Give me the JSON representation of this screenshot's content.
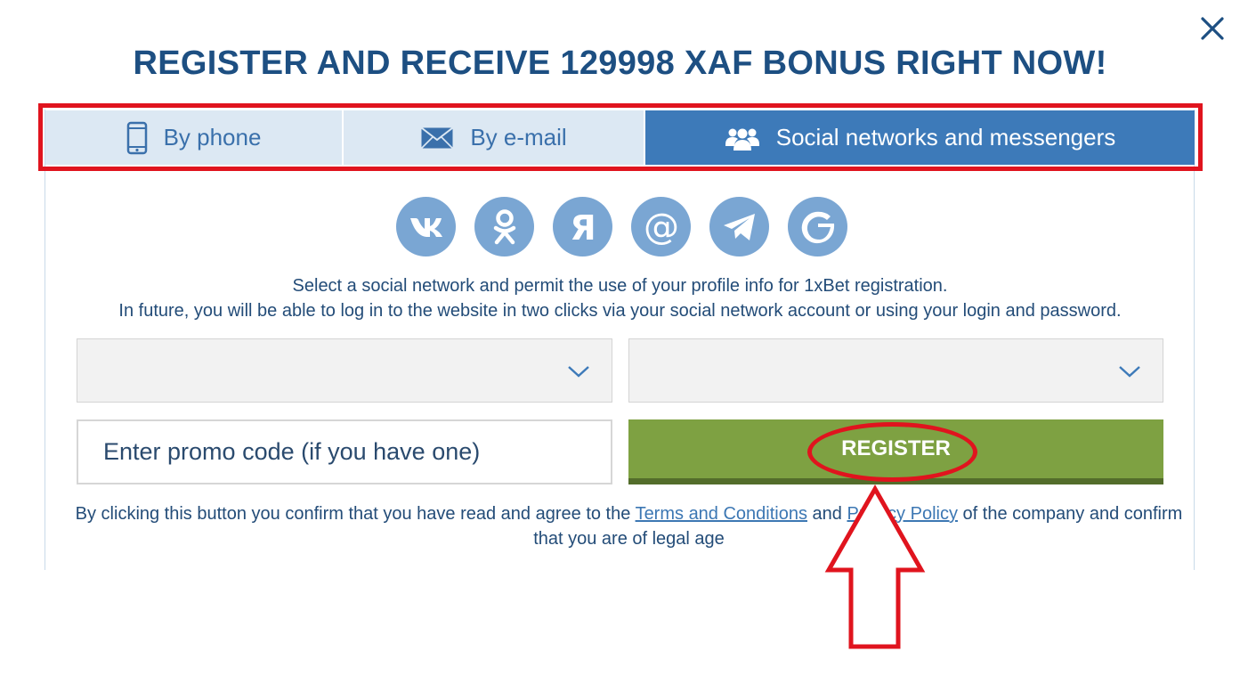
{
  "header": {
    "title": "REGISTER AND RECEIVE 129998 XAF BONUS RIGHT NOW!",
    "close_icon": "close-icon"
  },
  "tabs": [
    {
      "label": "By phone",
      "icon": "phone-icon",
      "active": false
    },
    {
      "label": "By e-mail",
      "icon": "envelope-icon",
      "active": false
    },
    {
      "label": "Social networks and messengers",
      "icon": "users-icon",
      "active": true
    }
  ],
  "socials": [
    {
      "name": "VK",
      "icon": "vk-icon"
    },
    {
      "name": "Odnoklassniki",
      "icon": "odnoklassniki-icon"
    },
    {
      "name": "Yandex",
      "icon": "yandex-icon"
    },
    {
      "name": "Mail.ru",
      "icon": "mail-at-icon"
    },
    {
      "name": "Telegram",
      "icon": "telegram-icon"
    },
    {
      "name": "Google",
      "icon": "google-icon"
    }
  ],
  "info": {
    "line1": "Select a social network and permit the use of your profile info for 1xBet registration.",
    "line2": "In future, you will be able to log in to the website in two clicks via your social network account or using your login and password."
  },
  "form": {
    "country_select_value": "",
    "currency_select_value": "",
    "promo_placeholder": "Enter promo code (if you have one)",
    "register_label": "REGISTER"
  },
  "terms": {
    "prefix": "By clicking this button you confirm that you have read and agree to the ",
    "terms_link": "Terms and Conditions",
    "and": " and ",
    "privacy_link": "Privacy Policy",
    "suffix": " of the company and confirm that you are of legal age"
  },
  "colors": {
    "title": "#1d4f82",
    "tab_inactive_bg": "#dce8f3",
    "tab_active_bg": "#3d7ab9",
    "social_bg": "#7aa6d3",
    "register_bg": "#7ea142",
    "highlight_red": "#e0141e"
  }
}
